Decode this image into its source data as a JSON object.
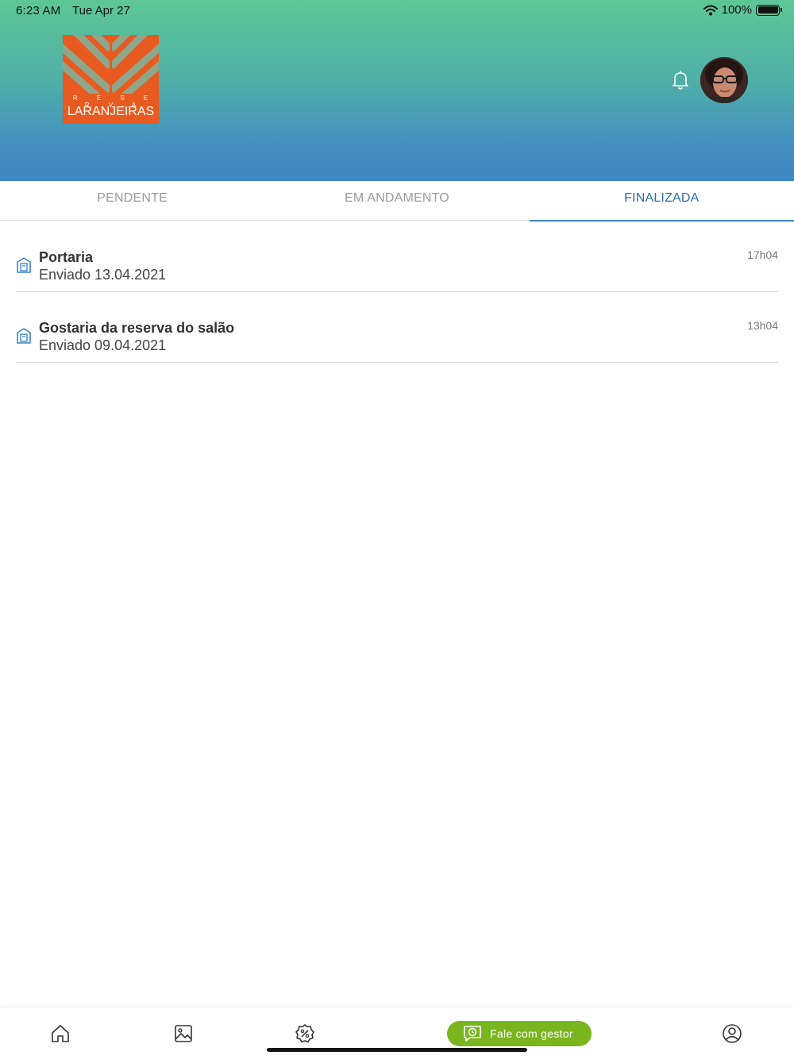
{
  "status_bar": {
    "time": "6:23 AM",
    "date": "Tue Apr 27",
    "battery": "100%"
  },
  "logo": {
    "line1": "R E S E R V A",
    "line2": "LARANJEIRAS",
    "brand_color": "#e85a1f"
  },
  "header": {
    "gradient_top": "#5dc796",
    "gradient_bottom": "#3f86c5",
    "icons": [
      "bell-icon",
      "avatar"
    ]
  },
  "tabs": [
    {
      "label": "PENDENTE",
      "active": false
    },
    {
      "label": "EM ANDAMENTO",
      "active": false
    },
    {
      "label": "FINALIZADA",
      "active": true
    }
  ],
  "items": [
    {
      "title": "Portaria",
      "subtitle": "Enviado 13.04.2021",
      "time": "17h04",
      "icon": "building-icon"
    },
    {
      "title": "Gostaria da reserva do salão",
      "subtitle": "Enviado 09.04.2021",
      "time": "13h04",
      "icon": "building-icon"
    }
  ],
  "bottom_nav": {
    "icons": [
      "home-icon",
      "gallery-icon",
      "discount-icon",
      "profile-icon"
    ],
    "cta_label": "Fale com gestor",
    "cta_icon": "chat-clock-icon",
    "cta_color": "#7ab51d"
  }
}
